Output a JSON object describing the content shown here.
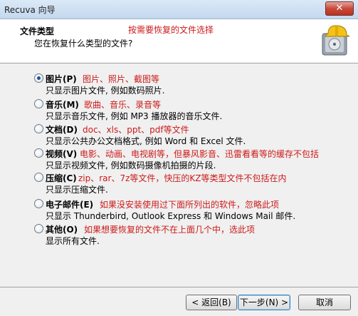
{
  "window": {
    "title": "Recuva 向导",
    "close_glyph": "✕"
  },
  "header": {
    "title": "文件类型",
    "subtitle": "您在恢复什么类型的文件?",
    "note": "按需要恢复的文件选择",
    "icon": "recuva-helmet-drive-icon"
  },
  "options": [
    {
      "label": "图片(P)",
      "note": "图片、照片、截图等",
      "desc": "只显示图片文件, 例如数码照片.",
      "checked": true
    },
    {
      "label": "音乐(M)",
      "note": "歌曲、音乐、录音等",
      "desc": "只显示音乐文件, 例如 MP3 播放器的音乐文件.",
      "checked": false
    },
    {
      "label": "文档(D)",
      "note": "doc、xls、ppt、pdf等文件",
      "desc": "只显示公共办公文档格式, 例如 Word 和 Excel 文件.",
      "checked": false
    },
    {
      "label": "视频(V)",
      "note": "电影、动画、电视剧等，但暴风影音、迅雷看看等的缓存不包括",
      "desc": "只显示视频文件, 例如数码摄像机拍摄的片段.",
      "checked": false
    },
    {
      "label": "压缩(C)",
      "note": "zip、rar、7z等文件，快压的KZ等类型文件不包括在内",
      "desc": "只显示压缩文件.",
      "checked": false
    },
    {
      "label": "电子邮件(E)",
      "note": "如果没安装使用过下面所列出的软件，忽略此项",
      "desc": "只显示 Thunderbird, Outlook Express 和 Windows Mail 邮件.",
      "checked": false
    },
    {
      "label": "其他(O)",
      "note": "如果想要恢复的文件不在上面几个中，选此项",
      "desc": "显示所有文件.",
      "checked": false
    }
  ],
  "buttons": {
    "back": "< 返回(B)",
    "next": "下一步(N) >",
    "cancel": "取消"
  }
}
